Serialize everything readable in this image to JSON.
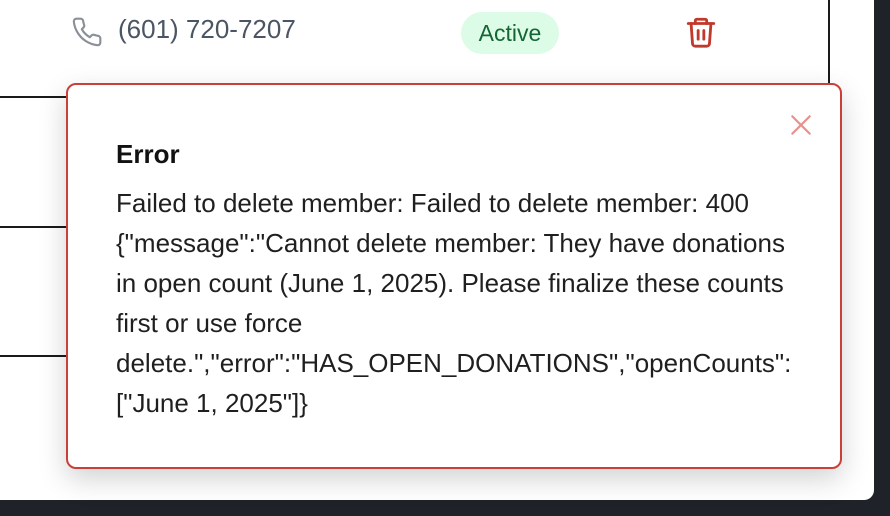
{
  "member_row": {
    "phone": "(601) 720-7207",
    "status": "Active"
  },
  "toast": {
    "title": "Error",
    "message_lines": [
      "Failed to delete member: Failed to delete member: 400",
      "{\"message\":\"Cannot delete member: They have donations",
      "in open count (June 1, 2025). Please finalize these counts",
      "first or use force",
      "delete.\",\"error\":\"HAS_OPEN_DONATIONS\",\"openCounts\":",
      "[\"June 1, 2025\"]}"
    ]
  },
  "colors": {
    "status_bg": "#dcfce7",
    "status_text": "#166534",
    "delete_icon": "#c0392b",
    "toast_border": "#c9403a",
    "close_icon": "#e8908a"
  },
  "icons": {
    "phone": "phone-icon",
    "delete": "trash-icon",
    "close": "close-icon"
  }
}
